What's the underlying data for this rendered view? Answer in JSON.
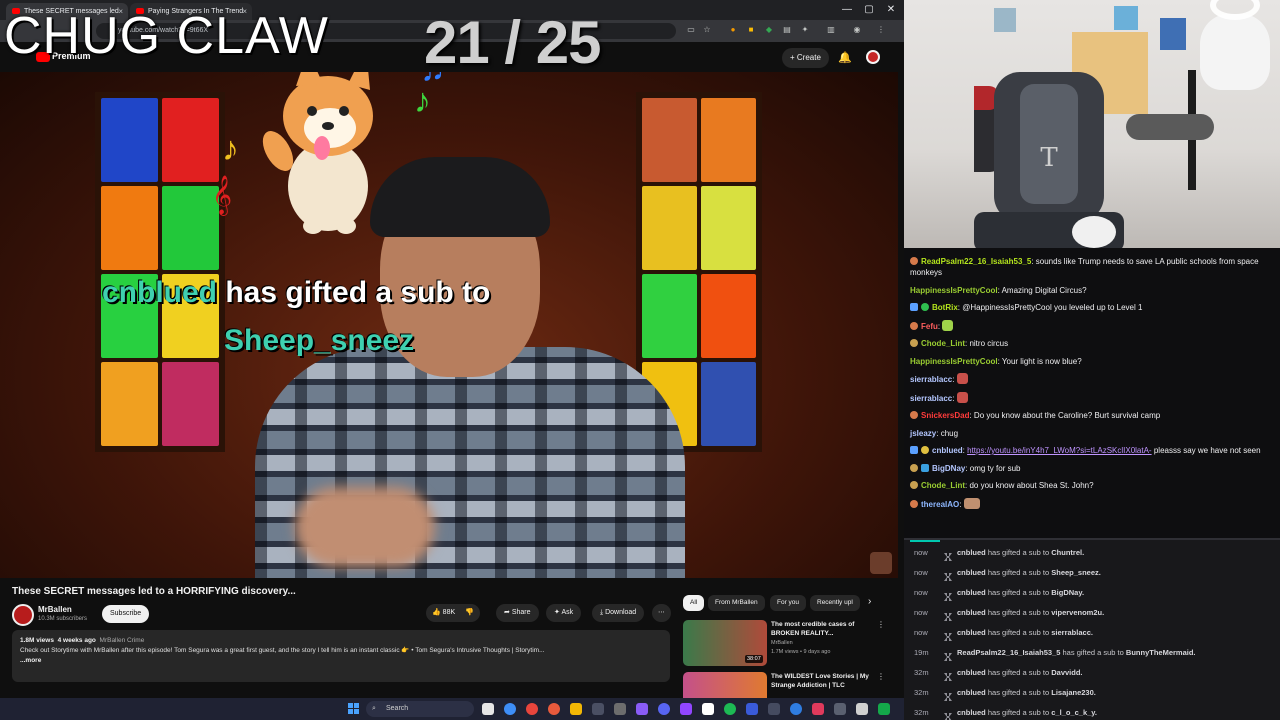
{
  "browser": {
    "tabs": [
      {
        "title": "These SECRET messages led"
      },
      {
        "title": "Paying Strangers In The Trend"
      }
    ],
    "window_controls": {
      "minimize": "—",
      "maximize": "▢",
      "close": "✕"
    },
    "address": "youtube.com/watch?v=9t66X",
    "youtube_brand": "Premium",
    "create_label": "Create"
  },
  "overlay": {
    "title": "CHUG CLAW",
    "counter": "21 / 25",
    "gift_user": "cnblued",
    "gift_text": "has gifted a sub to",
    "gift_recipient": "Sheep_sneez"
  },
  "video_info": {
    "title": "These SECRET messages led to a HORRIFYING discovery...",
    "channel": "MrBallen",
    "subscribers": "10.3M subscribers",
    "subscribe_label": "Subscribe",
    "likes": "88K",
    "share_label": "Share",
    "ask_label": "Ask",
    "download_label": "Download",
    "views": "1.8M views",
    "age": "4 weeks ago",
    "category": "MrBallen Crime",
    "description": "Check out Storytime with MrBallen after this episode! Tom Segura was a great first guest, and the story I tell him is an instant classic 👉 • Tom Segura's Intrusive Thoughts | Storytim...",
    "more_label": "...more"
  },
  "suggestions": {
    "chips": [
      "All",
      "From MrBallen",
      "For you",
      "Recently upl"
    ],
    "items": [
      {
        "title": "The most credible cases of BROKEN REALITY...",
        "channel": "MrBallen",
        "meta": "1.7M views • 9 days ago",
        "duration": "38:07"
      },
      {
        "title": "The WILDEST Love Stories | My Strange Addiction | TLC",
        "channel": "",
        "meta": "",
        "duration": ""
      }
    ]
  },
  "chat": {
    "messages": [
      {
        "user": "ReadPsalm22_16_Isaiah53_5",
        "color": "#b5e61d",
        "text": "sounds like Trump needs to save LA public schools from space monkeys"
      },
      {
        "user": "HappinessIsPrettyCool",
        "color": "#9acd32",
        "text": "Amazing Digital Circus?"
      },
      {
        "user": "BotRix",
        "color": "#b5e61d",
        "text": "@HappinessIsPrettyCool you leveled up to Level 1"
      },
      {
        "user": "Fefu",
        "color": "#ff5e5e",
        "text": ""
      },
      {
        "user": "Chode_Lint",
        "color": "#9acd32",
        "text": "nitro circus"
      },
      {
        "user": "HappinessIsPrettyCool",
        "color": "#9acd32",
        "text": "Your light is now blue?"
      },
      {
        "user": "sierrablacc",
        "color": "#b4c7ff",
        "text": ""
      },
      {
        "user": "sierrablacc",
        "color": "#b4c7ff",
        "text": ""
      },
      {
        "user": "SnickersDad",
        "color": "#ff3b3b",
        "text": "Do you know about the Caroline? Burt survival camp"
      },
      {
        "user": "jsleazy",
        "color": "#b4c7ff",
        "text": "chug"
      },
      {
        "user": "cnblued",
        "color": "#b4c7ff",
        "text": "pleasss say we have not seen",
        "link": "https://youtu.be/inY4h7_LWoM?si=tLAzSKclIX0latA-"
      },
      {
        "user": "BigDNay",
        "color": "#b4c7ff",
        "text": "omg ty for sub"
      },
      {
        "user": "Chode_Lint",
        "color": "#9acd32",
        "text": "do you know about Shea St. John?"
      },
      {
        "user": "therealAO",
        "color": "#8fb8ff",
        "text": ""
      }
    ]
  },
  "events": {
    "verb": "has gifted a sub to",
    "items": [
      {
        "time": "now",
        "from": "cnblued",
        "to": "Chuntrel."
      },
      {
        "time": "now",
        "from": "cnblued",
        "to": "Sheep_sneez."
      },
      {
        "time": "now",
        "from": "cnblued",
        "to": "BigDNay."
      },
      {
        "time": "now",
        "from": "cnblued",
        "to": "vipervenom2u."
      },
      {
        "time": "now",
        "from": "cnblued",
        "to": "sierrablacc."
      },
      {
        "time": "19m",
        "from": "ReadPsalm22_16_Isaiah53_5",
        "to": "BunnyTheMermaid."
      },
      {
        "time": "32m",
        "from": "cnblued",
        "to": "Davvidd."
      },
      {
        "time": "32m",
        "from": "cnblued",
        "to": "Lisajane230."
      },
      {
        "time": "32m",
        "from": "cnblued",
        "to": "c_l_o_c_k_y."
      }
    ]
  },
  "taskbar": {
    "search_label": "Search"
  }
}
